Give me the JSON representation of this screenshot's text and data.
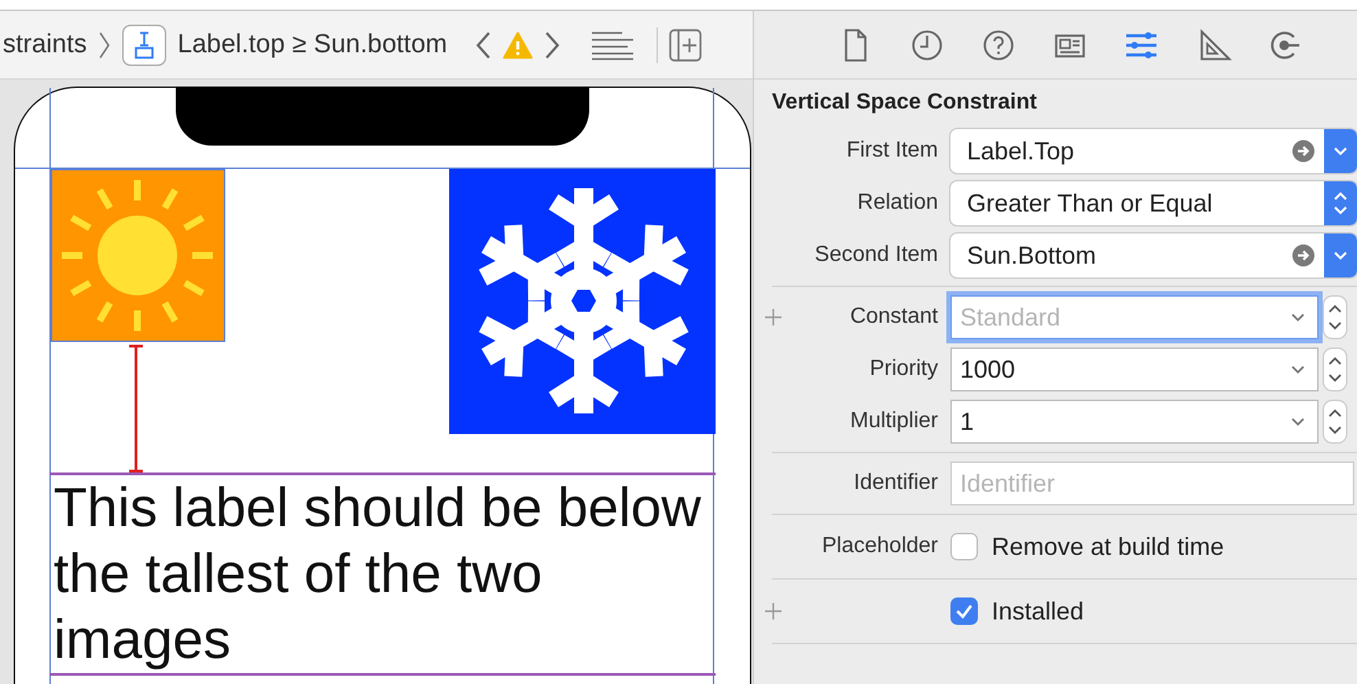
{
  "jump_bar": {
    "path_tail": "straints",
    "item": "Label.top ≥ Sun.bottom",
    "warning": true
  },
  "canvas": {
    "label_text": "This label should be below the tallest of the two images"
  },
  "inspector": {
    "tabs": [
      {
        "kind": "file",
        "selected": false
      },
      {
        "kind": "history",
        "selected": false
      },
      {
        "kind": "help",
        "selected": false
      },
      {
        "kind": "identity",
        "selected": false
      },
      {
        "kind": "attributes",
        "selected": true
      },
      {
        "kind": "size",
        "selected": false
      },
      {
        "kind": "connections",
        "selected": false
      }
    ],
    "title": "Vertical Space Constraint",
    "sections": [
      [
        {
          "kind": "item",
          "label": "First Item",
          "value": "Label.Top",
          "add_variation": false
        },
        {
          "kind": "popup",
          "label": "Relation",
          "value": "Greater Than or Equal",
          "add_variation": false
        },
        {
          "kind": "item",
          "label": "Second Item",
          "value": "Sun.Bottom",
          "add_variation": false
        }
      ],
      [
        {
          "kind": "combo",
          "label": "Constant",
          "placeholder": "Standard",
          "focused": true,
          "add_variation": true
        },
        {
          "kind": "combo",
          "label": "Priority",
          "value": "1000",
          "focused": false,
          "add_variation": false
        },
        {
          "kind": "combo",
          "label": "Multiplier",
          "value": "1",
          "focused": false,
          "add_variation": false
        }
      ],
      [
        {
          "kind": "text",
          "label": "Identifier",
          "placeholder": "Identifier",
          "add_variation": false
        }
      ],
      [
        {
          "kind": "checkbox",
          "label": "Placeholder",
          "text": "Remove at build time",
          "checked": false,
          "add_variation": false
        }
      ],
      [
        {
          "kind": "checkbox",
          "text": "Installed",
          "checked": true,
          "add_variation": true
        }
      ]
    ]
  }
}
